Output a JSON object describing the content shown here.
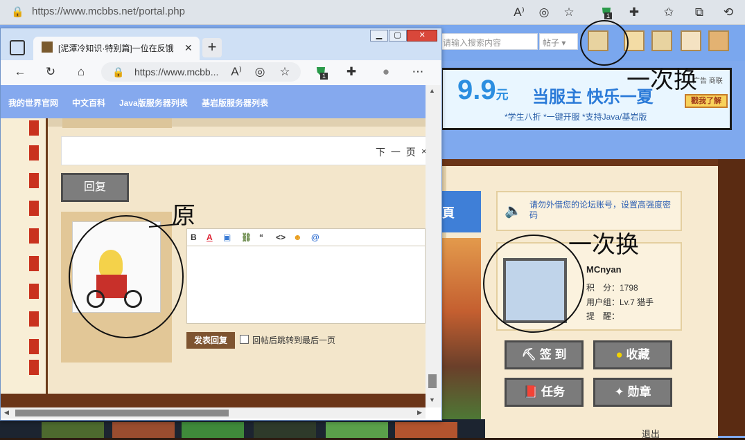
{
  "outer_browser": {
    "url": "https://www.mcbbs.net/portal.php",
    "tab_badge": "1"
  },
  "bg_page": {
    "search_placeholder": "请输入搜索内容",
    "search_type": "帖子",
    "banner": {
      "price": "9.9",
      "price_unit": "元",
      "title": "当服主 快乐一夏",
      "subtitle": "*学生八折   *一键开服   *支持Java/基岩版",
      "button": "戳我了解",
      "ad_label": "广告 商联"
    },
    "notice": "请勿外借您的论坛账号，设置高强度密码",
    "profile": {
      "username": "MCnyan",
      "points": "积　分：1798",
      "group": "用户组：Lv.7 猎手",
      "reminder": "提　醒："
    },
    "buttons": {
      "checkin": "签 到",
      "favorites": "收藏",
      "tasks": "任务",
      "medals": "勋章"
    },
    "logout": "退出",
    "scene_label": "頁"
  },
  "inner_window": {
    "tab_title": "[泥潭冷知识·特别篇]一位在反饿",
    "url": "https://www.mcbb...",
    "badge": "1",
    "nav": [
      "我的世界官网",
      "中文百科",
      "Java版服务器列表",
      "基岩版服务器列表"
    ],
    "next_page": "下 一 页",
    "next_close": "×",
    "reply_button": "回复",
    "toolbar": [
      "B",
      "A",
      "▣",
      "⛓",
      "“",
      "<>",
      "☻",
      "@"
    ],
    "submit": "发表回复",
    "jump_label": "回帖后跳转到最后一页"
  },
  "annotations": {
    "original": "原",
    "swapped_top": "一次换",
    "swapped_mid": "一次换"
  },
  "colors": {
    "nav_blue": "#85a9ee",
    "wood": "#6b3518",
    "parchment": "#f3e6cb"
  }
}
